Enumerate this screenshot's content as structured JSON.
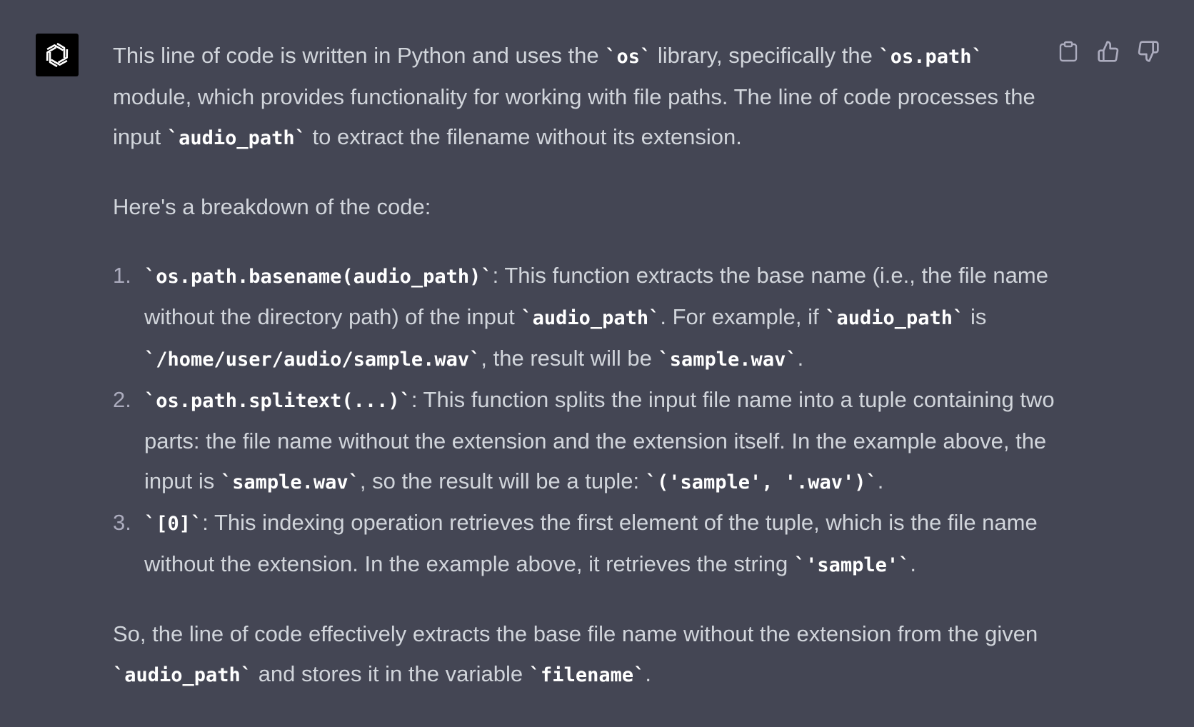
{
  "message": {
    "intro": [
      {
        "t": "text",
        "v": "This line of code is written in Python and uses the "
      },
      {
        "t": "code",
        "v": "`os`"
      },
      {
        "t": "text",
        "v": " library, specifically the "
      },
      {
        "t": "code",
        "v": "`os.path`"
      },
      {
        "t": "text",
        "v": " module, which provides functionality for working with file paths. The line of code processes the input "
      },
      {
        "t": "code",
        "v": "`audio_path`"
      },
      {
        "t": "text",
        "v": " to extract the filename without its extension."
      }
    ],
    "breakdown_heading": "Here's a breakdown of the code:",
    "list_items": [
      {
        "number": "1.",
        "parts": [
          {
            "t": "code",
            "v": "`os.path.basename(audio_path)`"
          },
          {
            "t": "text",
            "v": ": This function extracts the base name (i.e., the file name without the directory path) of the input "
          },
          {
            "t": "code",
            "v": "`audio_path`"
          },
          {
            "t": "text",
            "v": ". For example, if "
          },
          {
            "t": "code",
            "v": "`audio_path`"
          },
          {
            "t": "text",
            "v": " is "
          },
          {
            "t": "code",
            "v": "`/home/user/audio/sample.wav`"
          },
          {
            "t": "text",
            "v": ", the result will be "
          },
          {
            "t": "code",
            "v": "`sample.wav`"
          },
          {
            "t": "text",
            "v": "."
          }
        ]
      },
      {
        "number": "2.",
        "parts": [
          {
            "t": "code",
            "v": "`os.path.splitext(...)`"
          },
          {
            "t": "text",
            "v": ": This function splits the input file name into a tuple containing two parts: the file name without the extension and the extension itself. In the example above, the input is "
          },
          {
            "t": "code",
            "v": "`sample.wav`"
          },
          {
            "t": "text",
            "v": ", so the result will be a tuple: "
          },
          {
            "t": "code",
            "v": "`('sample', '.wav')`"
          },
          {
            "t": "text",
            "v": "."
          }
        ]
      },
      {
        "number": "3.",
        "parts": [
          {
            "t": "code",
            "v": "`[0]`"
          },
          {
            "t": "text",
            "v": ": This indexing operation retrieves the first element of the tuple, which is the file name without the extension. In the example above, it retrieves the string "
          },
          {
            "t": "code",
            "v": "`'sample'`"
          },
          {
            "t": "text",
            "v": "."
          }
        ]
      }
    ],
    "conclusion": [
      {
        "t": "text",
        "v": "So, the line of code effectively extracts the base file name without the extension from the given "
      },
      {
        "t": "code",
        "v": "`audio_path`"
      },
      {
        "t": "text",
        "v": " and stores it in the variable "
      },
      {
        "t": "code",
        "v": "`filename`"
      },
      {
        "t": "text",
        "v": "."
      }
    ]
  },
  "icons": {
    "avatar": "openai-logo-icon",
    "copy": "clipboard-icon",
    "like": "thumbs-up-icon",
    "dislike": "thumbs-down-icon"
  },
  "colors": {
    "background": "#444654",
    "text": "#d1d5db",
    "code": "#ffffff",
    "list_number": "#acacbe",
    "icon": "#acacbe"
  }
}
